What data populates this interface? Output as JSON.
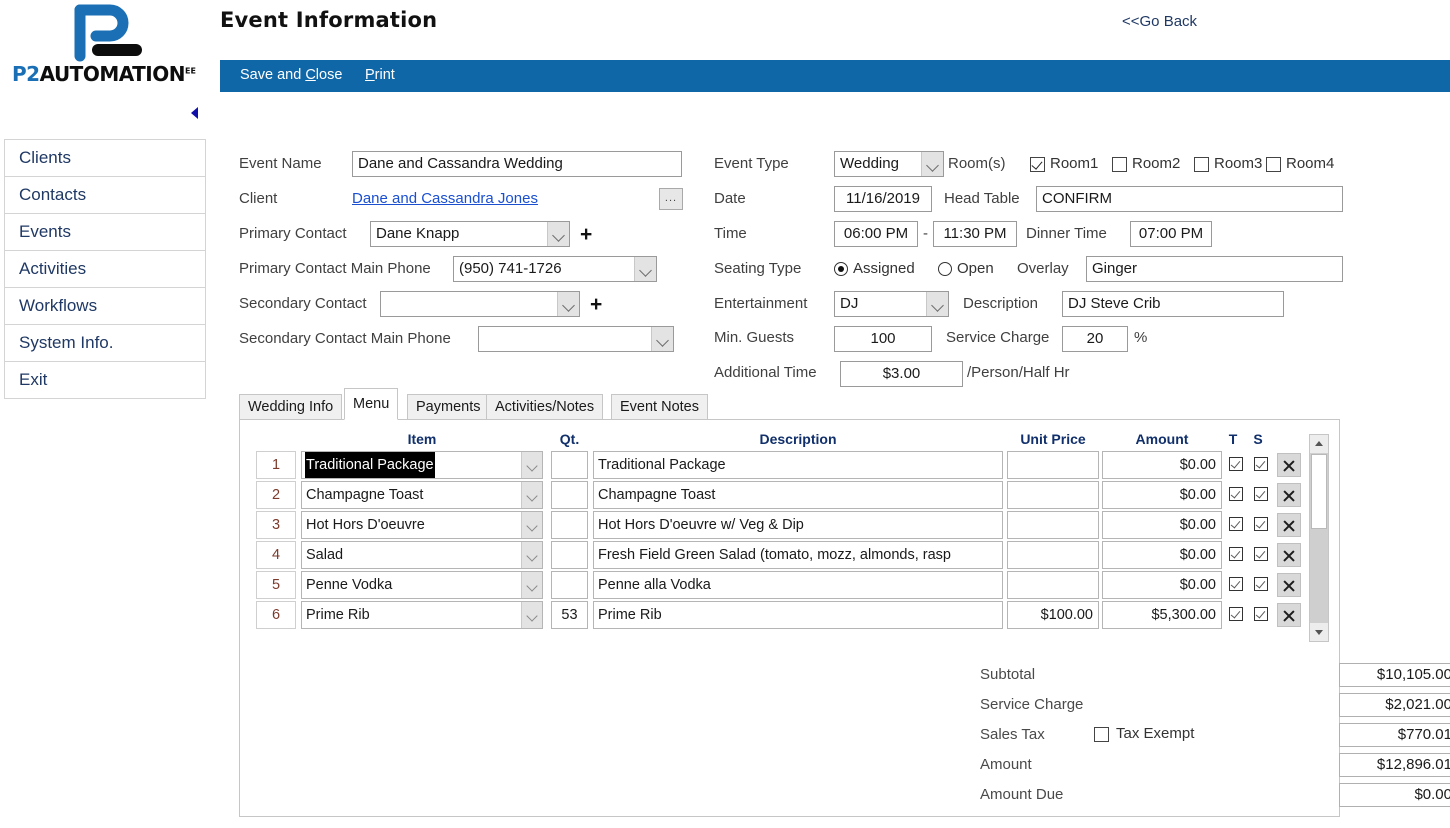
{
  "logo": {
    "p2": "P2",
    "automation": "AUTOMATION",
    "superscript": "EE"
  },
  "header": {
    "title": "Event Information",
    "go_back": "<<Go Back",
    "accent_color": "#1067a8"
  },
  "toolbar": {
    "save_prefix": "Save and ",
    "save_accel": "C",
    "save_suffix": "lose",
    "print_accel": "P",
    "print_suffix": "rint"
  },
  "sidebar": {
    "items": [
      {
        "label": "Clients"
      },
      {
        "label": "Contacts"
      },
      {
        "label": "Events"
      },
      {
        "label": "Activities"
      },
      {
        "label": "Workflows"
      },
      {
        "label": "System Info."
      },
      {
        "label": "Exit"
      }
    ]
  },
  "form": {
    "event_name_label": "Event Name",
    "event_name_value": "Dane and Cassandra Wedding",
    "client_label": "Client",
    "client_value": "Dane and Cassandra Jones",
    "client_browse": "...",
    "primary_contact_label": "Primary Contact",
    "primary_contact_value": "Dane Knapp",
    "primary_phone_label": "Primary Contact Main Phone",
    "primary_phone_value": "(950) 741-1726",
    "secondary_contact_label": "Secondary Contact",
    "secondary_contact_value": "",
    "secondary_phone_label": "Secondary Contact Main Phone",
    "secondary_phone_value": "",
    "add_plus": "+",
    "event_type_label": "Event Type",
    "event_type_value": "Wedding",
    "rooms_label": "Room(s)",
    "rooms": [
      {
        "label": "Room1",
        "checked": true
      },
      {
        "label": "Room2",
        "checked": false
      },
      {
        "label": "Room3",
        "checked": false
      },
      {
        "label": "Room4",
        "checked": false
      }
    ],
    "date_label": "Date",
    "date_value": "11/16/2019",
    "head_table_label": "Head Table",
    "head_table_value": "CONFIRM",
    "time_label": "Time",
    "time_start": "06:00 PM",
    "time_dash": "-",
    "time_end": "11:30 PM",
    "dinner_time_label": "Dinner Time",
    "dinner_time_value": "07:00 PM",
    "seating_type_label": "Seating Type",
    "seating_assigned": "Assigned",
    "seating_open": "Open",
    "seating_selected": "Assigned",
    "overlay_label": "Overlay",
    "overlay_value": "Ginger",
    "entertainment_label": "Entertainment",
    "entertainment_value": "DJ",
    "description_label": "Description",
    "description_value": "DJ Steve Crib",
    "min_guests_label": "Min. Guests",
    "min_guests_value": "100",
    "service_charge_label": "Service Charge",
    "service_charge_value": "20",
    "percent_sign": "%",
    "additional_time_label": "Additional Time",
    "additional_time_value": "$3.00",
    "additional_time_unit": "/Person/Half Hr"
  },
  "tabs": [
    {
      "label": "Wedding Info",
      "active": false
    },
    {
      "label": "Menu",
      "active": true
    },
    {
      "label": "Payments",
      "active": false
    },
    {
      "label": "Activities/Notes",
      "active": false
    },
    {
      "label": "Event Notes",
      "active": false
    }
  ],
  "grid": {
    "headers": {
      "item": "Item",
      "qt": "Qt.",
      "description": "Description",
      "unit_price": "Unit Price",
      "amount": "Amount",
      "t": "T",
      "s": "S"
    },
    "rows": [
      {
        "num": "1",
        "item": "Traditional Package",
        "qt": "",
        "desc": "Traditional Package",
        "price": "",
        "amount": "$0.00",
        "t": true,
        "s": true,
        "selected": true
      },
      {
        "num": "2",
        "item": "Champagne Toast",
        "qt": "",
        "desc": "Champagne Toast",
        "price": "",
        "amount": "$0.00",
        "t": true,
        "s": true,
        "selected": false
      },
      {
        "num": "3",
        "item": "Hot Hors D'oeuvre",
        "qt": "",
        "desc": "Hot Hors D'oeuvre w/ Veg & Dip",
        "price": "",
        "amount": "$0.00",
        "t": true,
        "s": true,
        "selected": false
      },
      {
        "num": "4",
        "item": "Salad",
        "qt": "",
        "desc": "Fresh Field Green Salad (tomato, mozz, almonds, rasp",
        "price": "",
        "amount": "$0.00",
        "t": true,
        "s": true,
        "selected": false
      },
      {
        "num": "5",
        "item": "Penne Vodka",
        "qt": "",
        "desc": "Penne alla Vodka",
        "price": "",
        "amount": "$0.00",
        "t": true,
        "s": true,
        "selected": false
      },
      {
        "num": "6",
        "item": "Prime Rib",
        "qt": "53",
        "desc": "Prime Rib",
        "price": "$100.00",
        "amount": "$5,300.00",
        "t": true,
        "s": true,
        "selected": false
      }
    ]
  },
  "totals": {
    "tax_exempt_label": "Tax Exempt",
    "tax_exempt_checked": false,
    "rows": [
      {
        "label": "Subtotal",
        "value": "$10,105.00"
      },
      {
        "label": "Service Charge",
        "value": "$2,021.00"
      },
      {
        "label": "Sales Tax",
        "value": "$770.01"
      },
      {
        "label": "Amount",
        "value": "$12,896.01"
      },
      {
        "label": "Amount Due",
        "value": "$0.00"
      }
    ]
  }
}
